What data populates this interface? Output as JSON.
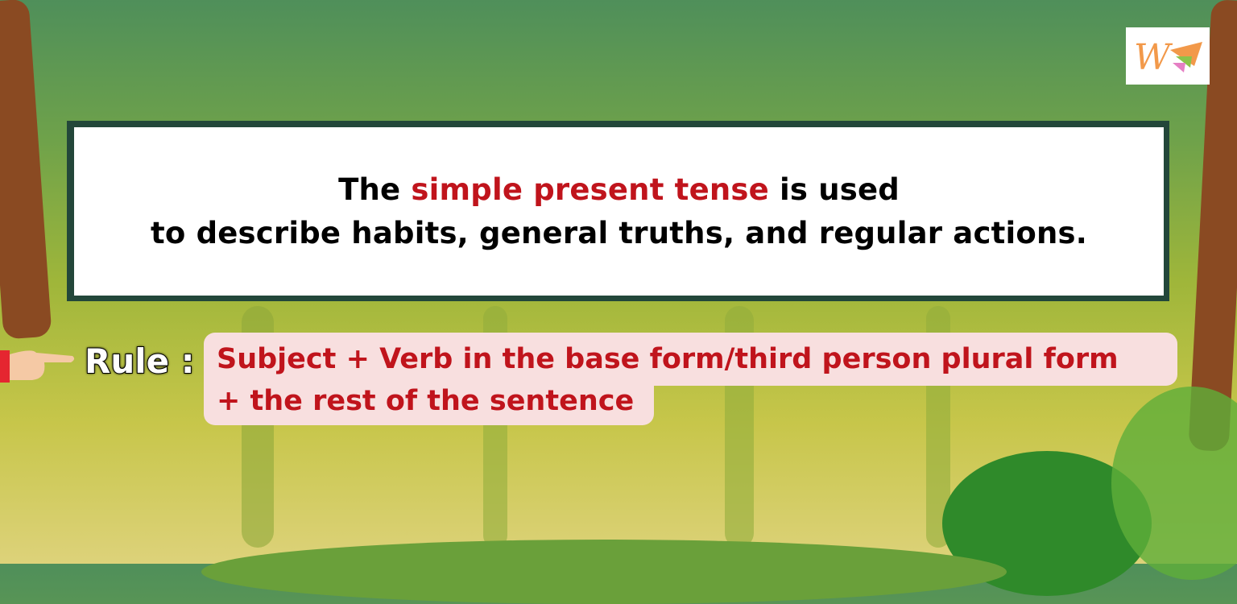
{
  "definition": {
    "line1_before": "The ",
    "line1_highlight": "simple present tense",
    "line1_after": " is used",
    "line2": "to describe habits, general truths, and regular actions."
  },
  "rule": {
    "label": "Rule :",
    "line1": "Subject + Verb in the base form/third person plural form",
    "line2": "+ the rest of the sentence"
  },
  "logo": {
    "letter": "W"
  },
  "colors": {
    "highlight": "#c0141c",
    "box_border": "#23473a",
    "rule_bg": "#f8dfdf"
  },
  "icons": [
    "pointing-hand-icon",
    "logo-icon"
  ]
}
